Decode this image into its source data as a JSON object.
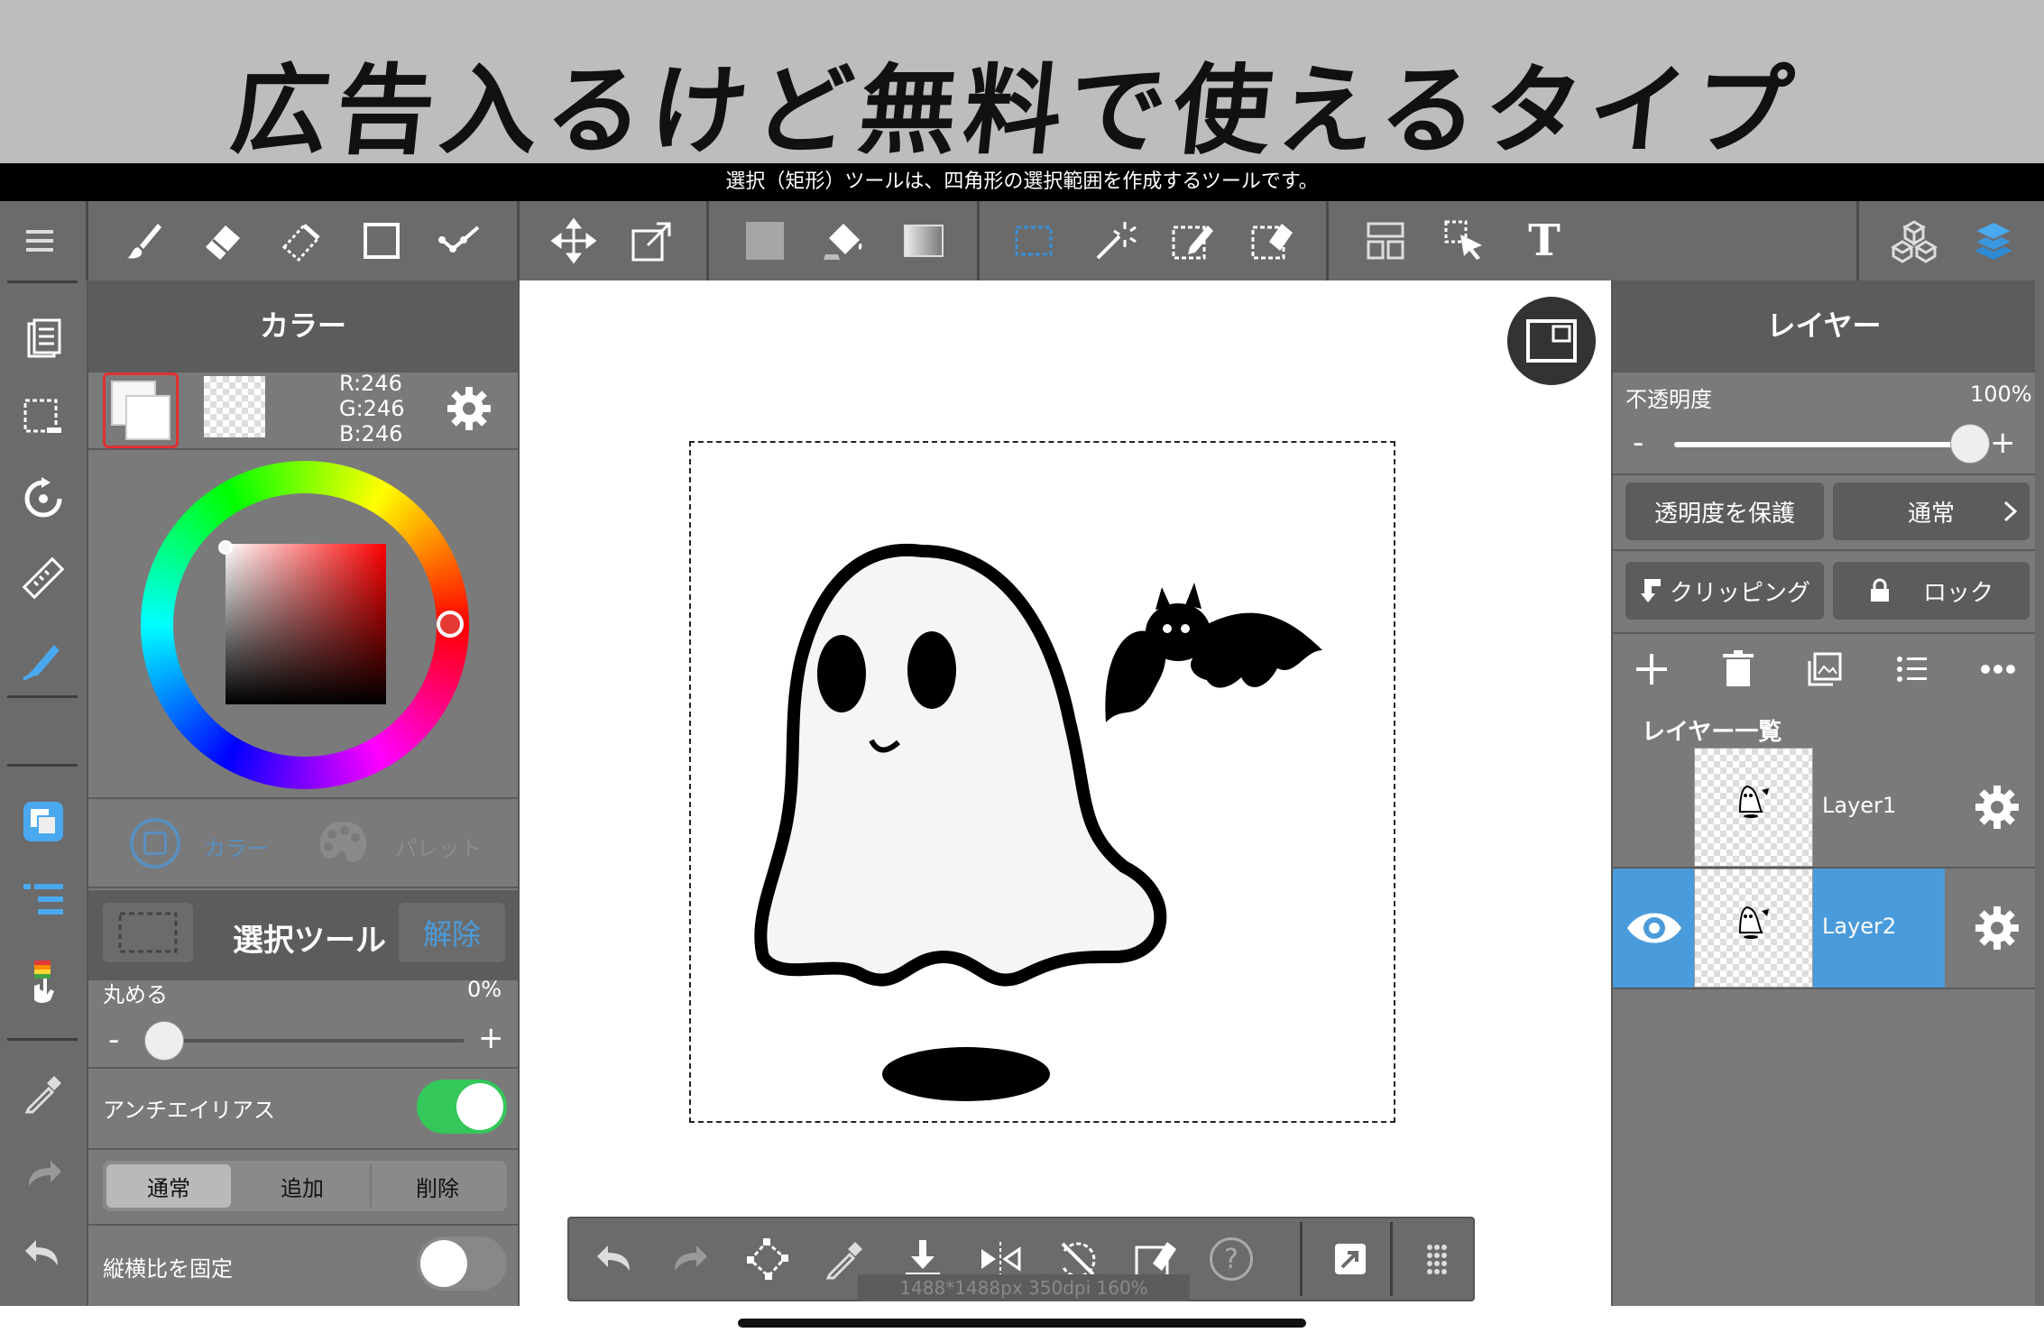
{
  "banner": {
    "text": "広告入るけど無料で使えるタイプ"
  },
  "tip": {
    "text": "選択（矩形）ツールは、四角形の選択範囲を作成するツールです。"
  },
  "toolbar": {
    "icons": [
      "menu-icon",
      "brush-icon",
      "eraser-icon",
      "blur-eraser-icon",
      "rectangle-icon",
      "line-icon",
      "move-icon",
      "transform-icon",
      "fill-color-icon",
      "bucket-icon",
      "gradient-icon",
      "select-rect-icon",
      "magic-wand-icon",
      "select-pen-icon",
      "select-eraser-icon",
      "layout-icon",
      "operation-icon",
      "text-icon",
      "material-icon",
      "layers-icon"
    ],
    "text_tool_glyph": "T"
  },
  "color_panel": {
    "title": "カラー",
    "rgb": {
      "r": "R:246",
      "g": "G:246",
      "b": "B:246"
    },
    "tab_color": "カラー",
    "tab_palette": "パレット",
    "main_color": "#f6f6f6",
    "hue_marker_color": "#e53935"
  },
  "selection_panel": {
    "title": "選択ツール",
    "release": "解除",
    "round_label": "丸める",
    "round_value": "0%",
    "round_slider": 0,
    "minus": "-",
    "plus": "+",
    "antialias_label": "アンチエイリアス",
    "antialias_on": true,
    "modes": [
      "通常",
      "追加",
      "削除"
    ],
    "mode_selected": "通常",
    "fix_ratio_label": "縦横比を固定",
    "fix_ratio_on": false
  },
  "layers_panel": {
    "title": "レイヤー",
    "opacity_label": "不透明度",
    "opacity_value": "100%",
    "opacity_slider": 1.0,
    "minus": "-",
    "plus": "+",
    "protect_alpha": "透明度を保護",
    "blend_mode": "通常",
    "clipping": "クリッピング",
    "lock": "ロック",
    "list_title": "レイヤー一覧",
    "layers": [
      {
        "name": "Layer1",
        "visible": false,
        "selected": false
      },
      {
        "name": "Layer2",
        "visible": true,
        "selected": true
      }
    ],
    "accent": "#4a9bdc"
  },
  "bottom_bar": {
    "status": "1488*1488px 350dpi 160%",
    "help_glyph": "?"
  }
}
